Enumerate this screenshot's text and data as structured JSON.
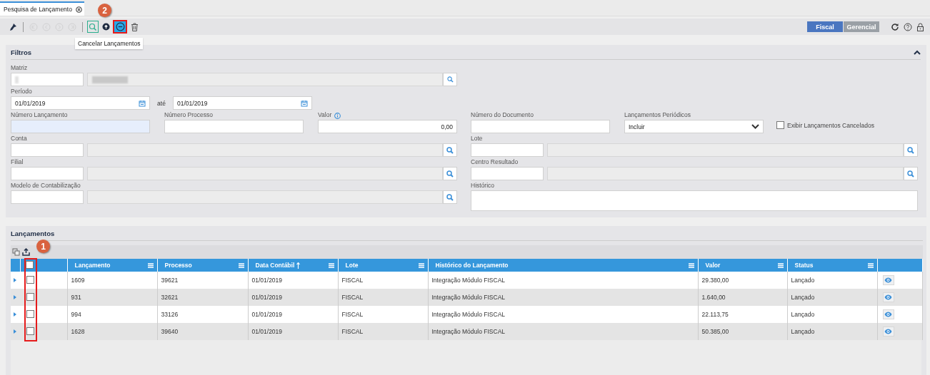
{
  "tab": {
    "label": "Pesquisa de Lançamento"
  },
  "toolbar_buttons": [
    {
      "kind": "brush",
      "disabled": false,
      "selected": false
    },
    {
      "kind": "first",
      "disabled": true,
      "selected": false
    },
    {
      "kind": "prev",
      "disabled": true,
      "selected": false
    },
    {
      "kind": "next",
      "disabled": true,
      "selected": false
    },
    {
      "kind": "last",
      "disabled": true,
      "selected": false
    },
    {
      "kind": "search",
      "disabled": false,
      "selected": false
    },
    {
      "kind": "up",
      "disabled": false,
      "selected": false
    },
    {
      "kind": "cancel",
      "disabled": false,
      "selected": true
    },
    {
      "kind": "trash",
      "disabled": false,
      "selected": false
    }
  ],
  "tooltip": "Cancelar Lançamentos",
  "view_toggle": [
    {
      "label": "Fiscal",
      "selected": true
    },
    {
      "label": "Gerencial",
      "selected": false
    }
  ],
  "callouts": [
    {
      "label": "1"
    },
    {
      "label": "2"
    }
  ],
  "filters": {
    "title": "Filtros",
    "expanded": true,
    "matriz": {
      "label": "Matriz"
    },
    "periodo": {
      "label": "Período",
      "from": "01/01/2019",
      "separator": "até",
      "to": "01/01/2019"
    },
    "numero_lancamento": {
      "label": "Número Lançamento",
      "highlighted": true
    },
    "numero_processo": {
      "label": "Número Processo"
    },
    "valor": {
      "label": "Valor",
      "value": "0,00"
    },
    "numero_documento": {
      "label": "Número do Documento"
    },
    "lancamentos_periodicos": {
      "label": "Lançamentos Periódicos",
      "value": "Incluir"
    },
    "exibir_cancelados": {
      "label": "Exibir Lançamentos Cancelados",
      "checked": false
    },
    "conta": {
      "label": "Conta"
    },
    "lote": {
      "label": "Lote"
    },
    "filial": {
      "label": "Filial"
    },
    "centro_resultado": {
      "label": "Centro Resultado"
    },
    "modelo": {
      "label": "Modelo de Contabilização"
    },
    "historico": {
      "label": "Histórico"
    }
  },
  "grid": {
    "title": "Lançamentos",
    "select_all_checked": false,
    "columns": [
      {
        "label": "Lançamento",
        "sorted": false
      },
      {
        "label": "Processo",
        "sorted": false
      },
      {
        "label": "Data Contábil",
        "sorted": true
      },
      {
        "label": "Lote",
        "sorted": false
      },
      {
        "label": "Histórico do Lançamento",
        "sorted": false
      },
      {
        "label": "Valor",
        "sorted": false
      },
      {
        "label": "Status",
        "sorted": false
      }
    ],
    "rows": [
      {
        "checked": false,
        "cells": [
          "1609",
          "39621",
          "01/01/2019",
          "FISCAL",
          "Integração Módulo FISCAL",
          "29.380,00",
          "Lançado"
        ]
      },
      {
        "checked": false,
        "cells": [
          "931",
          "32621",
          "01/01/2019",
          "FISCAL",
          "Integração Módulo FISCAL",
          "1.640,00",
          "Lançado"
        ]
      },
      {
        "checked": false,
        "cells": [
          "994",
          "33126",
          "01/01/2019",
          "FISCAL",
          "Integração Módulo FISCAL",
          "22.113,75",
          "Lançado"
        ]
      },
      {
        "checked": false,
        "cells": [
          "1628",
          "39640",
          "01/01/2019",
          "FISCAL",
          "Integração Módulo FISCAL",
          "50.385,00",
          "Lançado"
        ]
      }
    ]
  }
}
